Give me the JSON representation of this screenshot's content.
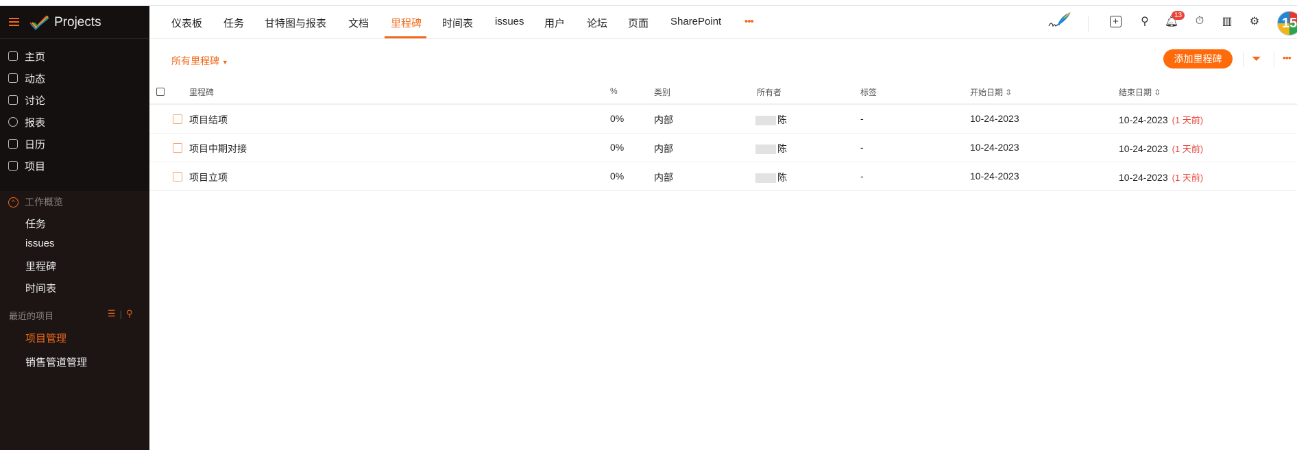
{
  "app": {
    "title": "Projects"
  },
  "sidebar": {
    "items": [
      {
        "label": "主页",
        "icon": "home-icon"
      },
      {
        "label": "动态",
        "icon": "feed-icon"
      },
      {
        "label": "讨论",
        "icon": "discussion-icon"
      },
      {
        "label": "报表",
        "icon": "report-icon"
      },
      {
        "label": "日历",
        "icon": "calendar-icon"
      },
      {
        "label": "项目",
        "icon": "project-icon"
      }
    ],
    "section": "工作概览",
    "sub_items": [
      "任务",
      "issues",
      "里程碑",
      "时间表"
    ],
    "recent_label": "最近的项目",
    "recent": [
      "项目管理",
      "销售管道管理"
    ]
  },
  "tabs": [
    "仪表板",
    "任务",
    "甘特图与报表",
    "文档",
    "里程碑",
    "时间表",
    "issues",
    "用户",
    "论坛",
    "页面",
    "SharePoint"
  ],
  "more_tabs": "•••",
  "header": {
    "notification_count": "13",
    "avatar_text": "15"
  },
  "toolbar": {
    "filter": "所有里程碑",
    "add_button": "添加里程碑",
    "more": "•••"
  },
  "table": {
    "columns": [
      "里程碑",
      "%",
      "类别",
      "所有者",
      "标签",
      "开始日期",
      "结束日期"
    ],
    "rows": [
      {
        "name": "项目结项",
        "percent": "0%",
        "category": "内部",
        "owner": "陈",
        "tag": "-",
        "start": "10-24-2023",
        "end": "10-24-2023",
        "overdue": "(1 天前)"
      },
      {
        "name": "项目中期对接",
        "percent": "0%",
        "category": "内部",
        "owner": "陈",
        "tag": "-",
        "start": "10-24-2023",
        "end": "10-24-2023",
        "overdue": "(1 天前)"
      },
      {
        "name": "项目立项",
        "percent": "0%",
        "category": "内部",
        "owner": "陈",
        "tag": "-",
        "start": "10-24-2023",
        "end": "10-24-2023",
        "overdue": "(1 天前)"
      }
    ]
  },
  "colors": {
    "accent": "#f26a1b",
    "sidebar": "#1c1513",
    "overdue": "#e8453c"
  }
}
